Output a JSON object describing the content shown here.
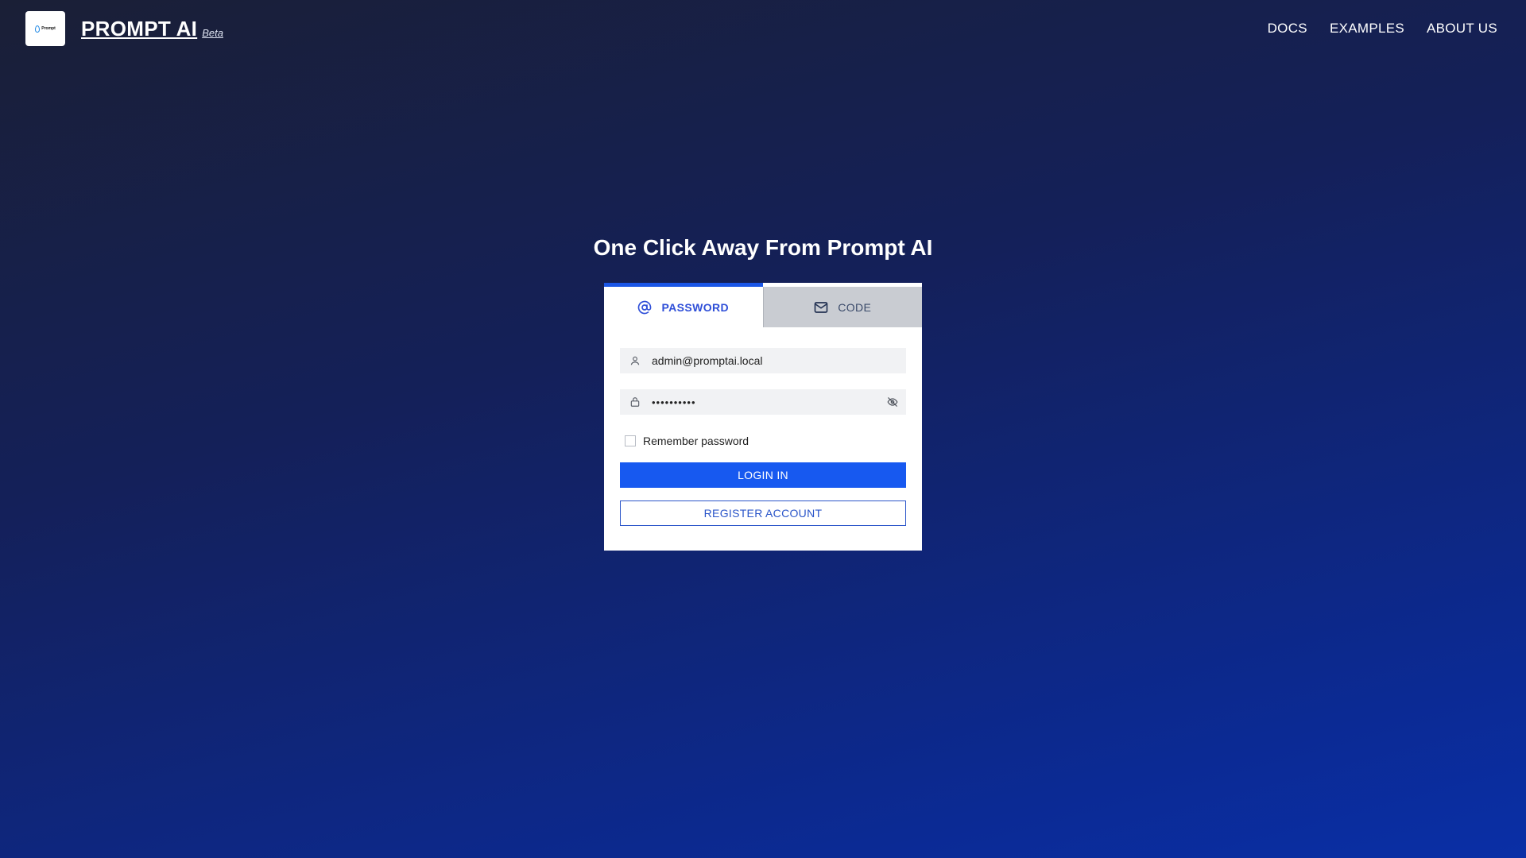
{
  "header": {
    "logo_text": "Prompt",
    "brand_name": "PROMPT AI",
    "brand_badge": "Beta",
    "nav": [
      {
        "label": "DOCS"
      },
      {
        "label": "EXAMPLES"
      },
      {
        "label": "ABOUT US"
      }
    ]
  },
  "page": {
    "title": "One Click Away From Prompt AI"
  },
  "login": {
    "tabs": [
      {
        "label": "PASSWORD",
        "icon": "at-sign-icon",
        "active": true
      },
      {
        "label": "CODE",
        "icon": "envelope-icon",
        "active": false
      }
    ],
    "username": {
      "value": "admin@promptai.local",
      "icon": "user-icon"
    },
    "password": {
      "value": "••••••••••",
      "icon": "lock-icon",
      "toggle_icon": "eye-off-icon"
    },
    "remember_label": "Remember password",
    "remember_checked": false,
    "login_button": "LOGIN IN",
    "register_button": "REGISTER ACCOUNT"
  },
  "colors": {
    "primary": "#1759f0",
    "tab_active_text": "#2f4fd8",
    "background_start": "#1a1f36",
    "background_end": "#0a2fa6"
  }
}
